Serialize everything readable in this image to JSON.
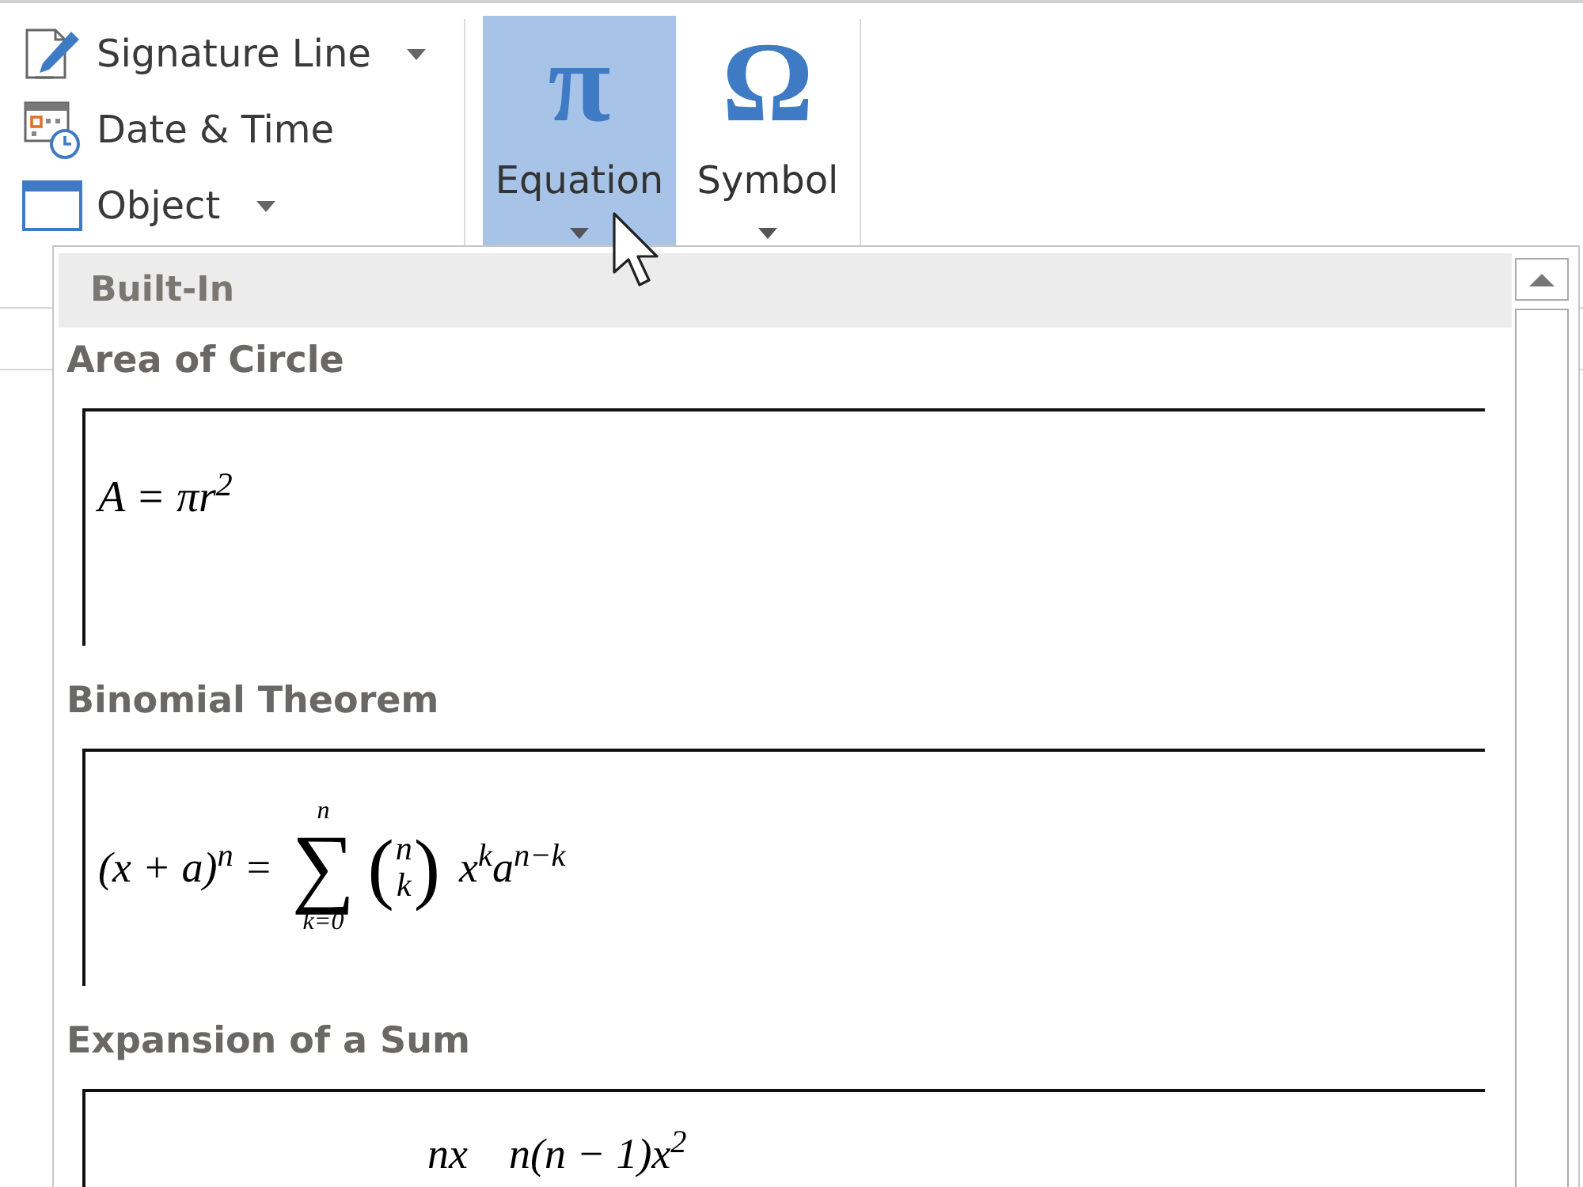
{
  "ribbon": {
    "small_commands": [
      {
        "label": "Signature Line",
        "dropdown": true
      },
      {
        "label": "Date & Time",
        "dropdown": false
      },
      {
        "label": "Object",
        "dropdown": true
      }
    ],
    "large_commands": [
      {
        "glyph": "π",
        "label": "Equation",
        "selected": true,
        "dropdown": true
      },
      {
        "glyph": "Ω",
        "label": "Symbol",
        "selected": false,
        "dropdown": true
      }
    ]
  },
  "gallery": {
    "heading": "Built-In",
    "items": [
      {
        "title": "Area of Circle",
        "equation": {
          "kind": "inline",
          "text": "A = πr$^{2}$"
        }
      },
      {
        "title": "Binomial Theorem",
        "equation": {
          "kind": "summation",
          "lhs": "(x + a)$^{n}$ =",
          "symbol": "∑",
          "upper": "n",
          "lower": "k=0",
          "open": "(",
          "top": "n",
          "bottom": "k",
          "close": ")",
          "rhs": "x$^{k}$a$^{n−k}$"
        }
      },
      {
        "title": "Expansion of a Sum",
        "equation": {
          "kind": "numerators",
          "terms": [
            "nx",
            "n(n − 1)x$^{2}$"
          ]
        }
      }
    ]
  }
}
